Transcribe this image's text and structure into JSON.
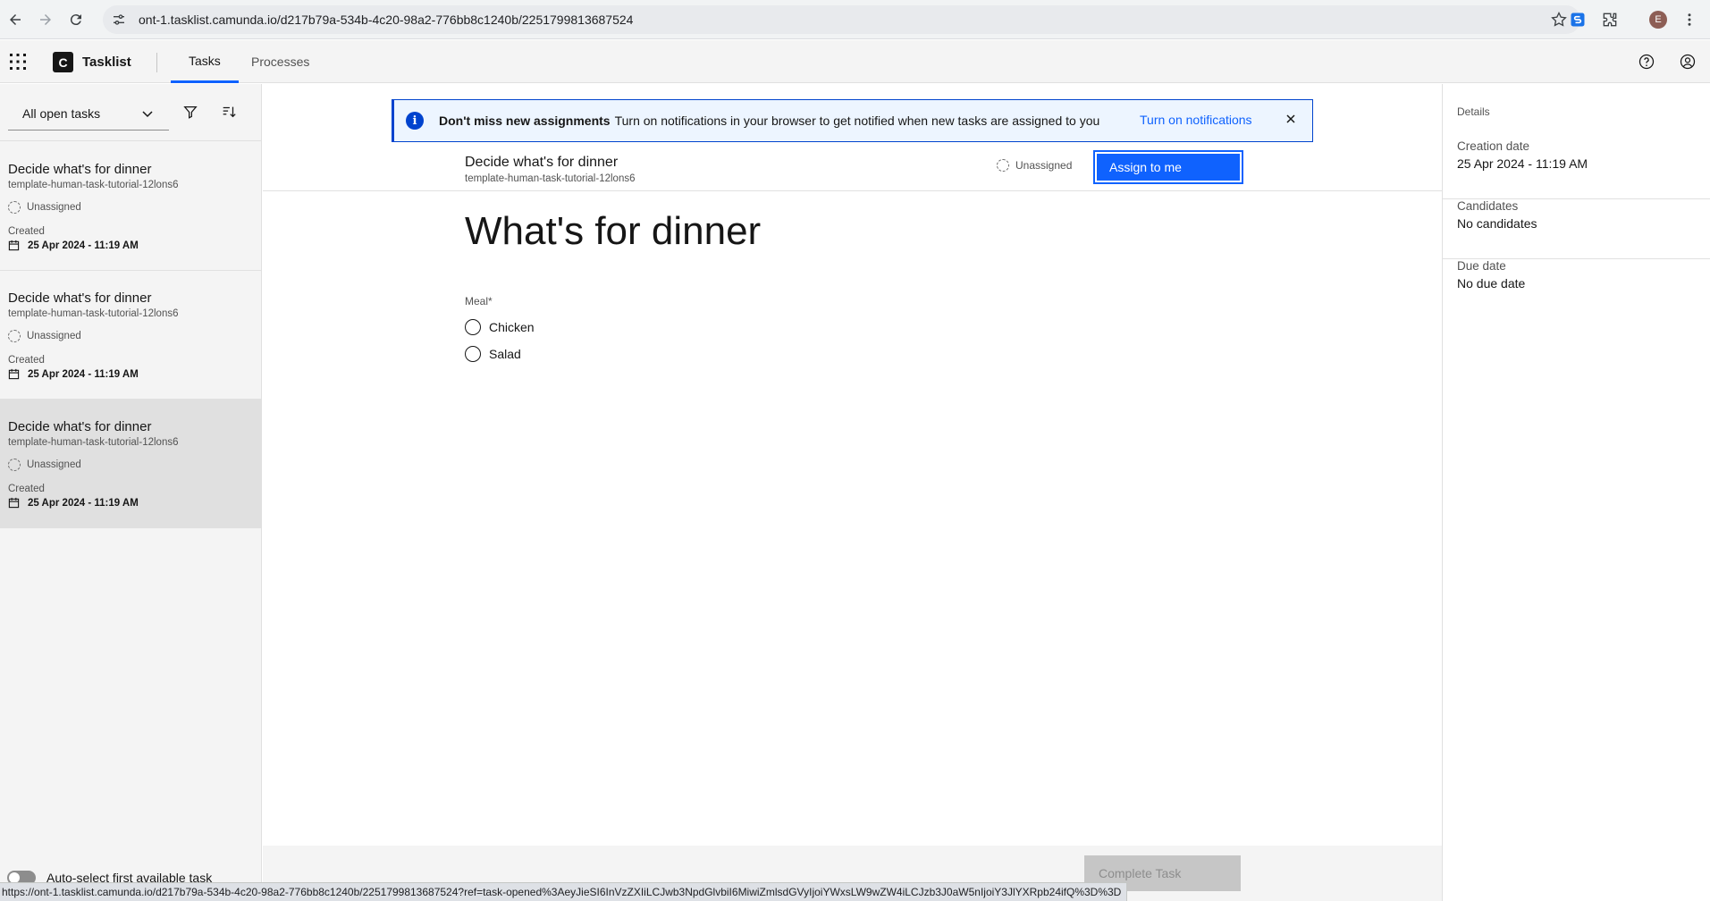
{
  "browser": {
    "url": "ont-1.tasklist.camunda.io/d217b79a-534b-4c20-98a2-776bb8c1240b/2251799813687524",
    "profile_initial": "E",
    "status_url": "https://ont-1.tasklist.camunda.io/d217b79a-534b-4c20-98a2-776bb8c1240b/2251799813687524?ref=task-opened%3AeyJieSI6InVzZXIiLCJwb3NpdGlvbiI6MiwiZmlsdGVyIjoiYWxsLW9wZW4iLCJzb3J0aW5nIjoiY3JlYXRpb24ifQ%3D%3D"
  },
  "header": {
    "logo_letter": "C",
    "app_name": "Tasklist",
    "tabs": [
      {
        "label": "Tasks",
        "active": true
      },
      {
        "label": "Processes",
        "active": false
      }
    ]
  },
  "sidebar": {
    "filter_value": "All open tasks",
    "tasks": [
      {
        "name": "Decide what's for dinner",
        "process": "template-human-task-tutorial-12lons6",
        "assignee": "Unassigned",
        "created_label": "Created",
        "created": "25 Apr 2024 - 11:19 AM"
      },
      {
        "name": "Decide what's for dinner",
        "process": "template-human-task-tutorial-12lons6",
        "assignee": "Unassigned",
        "created_label": "Created",
        "created": "25 Apr 2024 - 11:19 AM"
      },
      {
        "name": "Decide what's for dinner",
        "process": "template-human-task-tutorial-12lons6",
        "assignee": "Unassigned",
        "created_label": "Created",
        "created": "25 Apr 2024 - 11:19 AM"
      }
    ],
    "auto_select_label": "Auto-select first available task"
  },
  "notification": {
    "title": "Don't miss new assignments",
    "message": "Turn on notifications in your browser to get notified when new tasks are assigned to you",
    "action": "Turn on notifications"
  },
  "task": {
    "name": "Decide what's for dinner",
    "process": "template-human-task-tutorial-12lons6",
    "assignee": "Unassigned",
    "assign_button": "Assign to me",
    "form_title": "What's for dinner",
    "field_label": "Meal*",
    "options": [
      "Chicken",
      "Salad"
    ],
    "complete_button": "Complete Task"
  },
  "details": {
    "heading": "Details",
    "creation_label": "Creation date",
    "creation_value": "25 Apr 2024 - 11:19 AM",
    "candidates_label": "Candidates",
    "candidates_value": "No candidates",
    "due_label": "Due date",
    "due_value": "No due date"
  },
  "colors": {
    "accent": "#0f62fe",
    "notification_bg": "#edf5ff",
    "selected_task_bg": "#e0e0e0"
  }
}
